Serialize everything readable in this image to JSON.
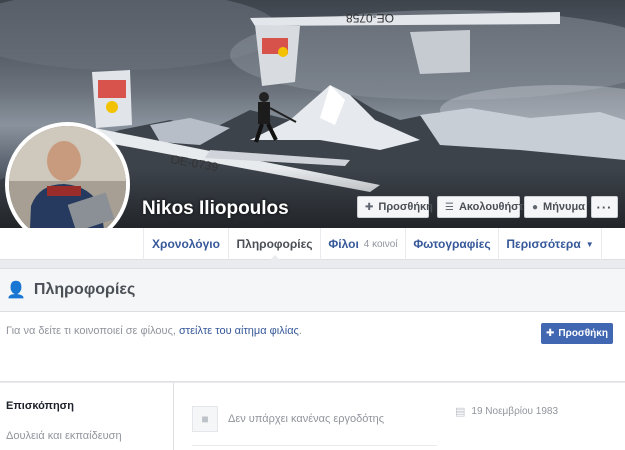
{
  "profile": {
    "name": "Nikos Iliopoulos"
  },
  "cover_actions": {
    "add_friend": "Προσθήκη",
    "follow": "Ακολουθήστε",
    "message": "Μήνυμα",
    "more": "···"
  },
  "nav": {
    "timeline": "Χρονολόγιο",
    "about": "Πληροφορίες",
    "friends": "Φίλοι",
    "friends_count": "4 κοινοί",
    "photos": "Φωτογραφίες",
    "more": "Περισσότερα"
  },
  "about": {
    "title": "Πληροφορίες",
    "friend_note_prefix": "Για να δείτε τι κοινοποιεί σε φίλους, ",
    "friend_note_link": "στείλτε του αίτημα φιλίας",
    "friend_note_suffix": ".",
    "add_button": "Προσθήκη"
  },
  "overview": {
    "section_title": "Επισκόπηση",
    "work_education": "Δουλειά και εκπαίδευση",
    "no_employer": "Δεν υπάρχει κανένας εργοδότης",
    "birthday": "19 Νοεμβρίου 1983"
  },
  "icons": {
    "add_friend": "person-plus-icon",
    "follow": "rss-icon",
    "message": "messenger-icon",
    "about": "person-icon",
    "employer": "briefcase-icon",
    "birthday": "cake-icon"
  },
  "colors": {
    "link_blue": "#365899",
    "button_blue": "#4267b2",
    "page_bg": "#e9ebee"
  }
}
